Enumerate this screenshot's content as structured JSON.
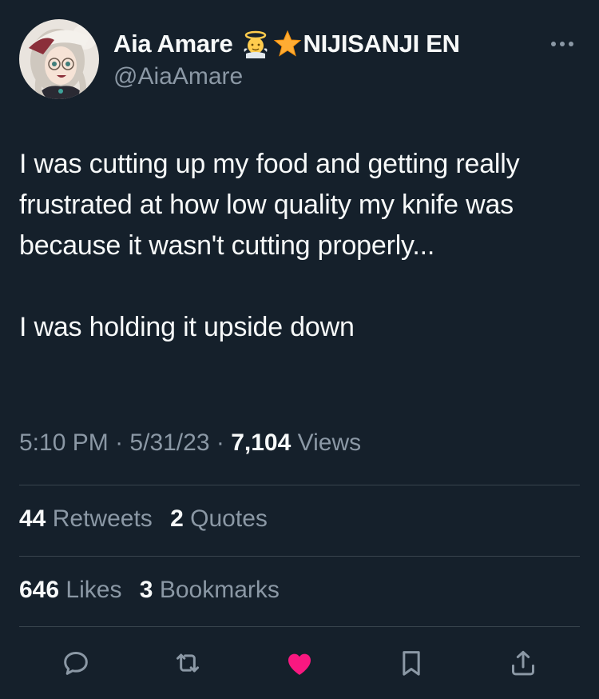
{
  "author": {
    "display_name": "Aia Amare",
    "emoji_1": "angel-emoji",
    "emoji_2": "star-emoji",
    "affiliation": "NIJISANJI EN",
    "handle": "@AiaAmare"
  },
  "tweet": {
    "text": "I was cutting up my food and getting really frustrated at how low quality my knife was because it wasn't cutting properly...\n\nI was holding it upside down",
    "time": "5:10 PM",
    "date": "5/31/23",
    "separator": "·",
    "views_count": "7,104",
    "views_label": "Views"
  },
  "stats": {
    "retweets_count": "44",
    "retweets_label": "Retweets",
    "quotes_count": "2",
    "quotes_label": "Quotes",
    "likes_count": "646",
    "likes_label": "Likes",
    "bookmarks_count": "3",
    "bookmarks_label": "Bookmarks"
  },
  "actions": [
    "reply-icon",
    "retweet-icon",
    "like-icon",
    "bookmark-icon",
    "share-icon"
  ],
  "colors": {
    "background": "#15202b",
    "text": "#f7f9f9",
    "secondary": "#8b98a5",
    "divider": "#38444d",
    "like": "#f91880"
  }
}
